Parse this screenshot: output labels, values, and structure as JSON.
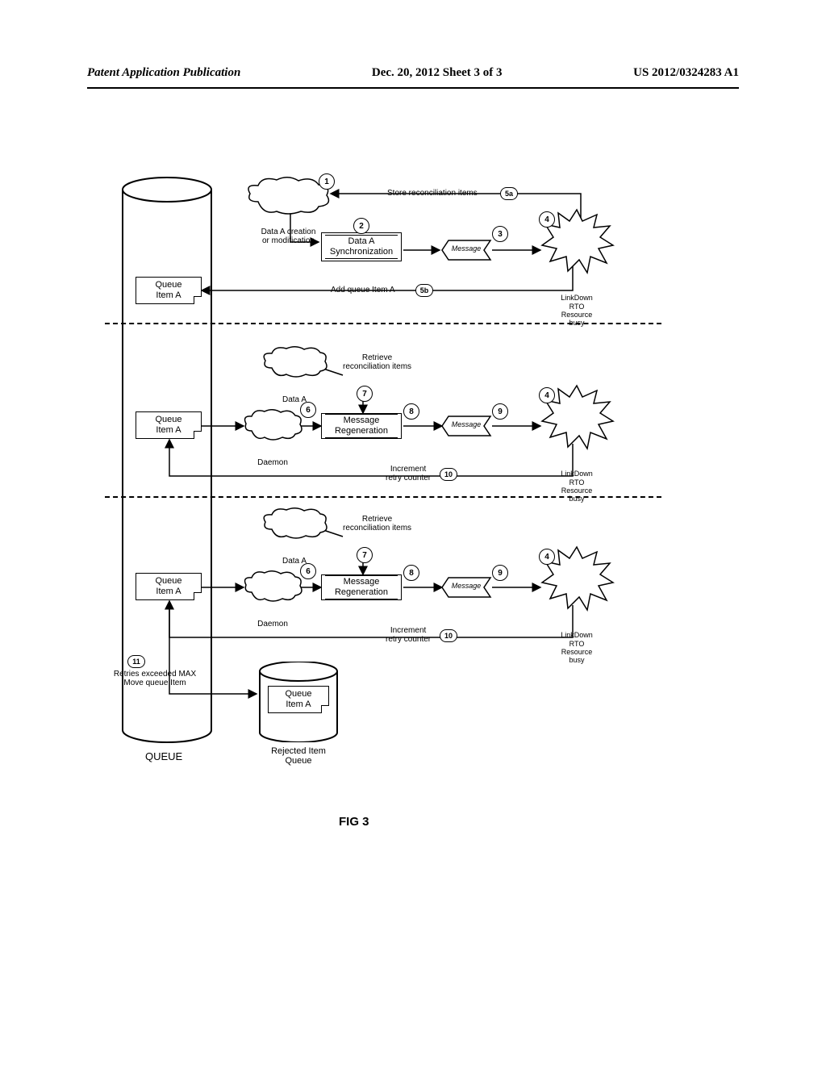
{
  "header": {
    "left": "Patent Application Publication",
    "mid": "Dec. 20, 2012  Sheet 3 of 3",
    "right": "US 2012/0324283 A1"
  },
  "figure_label": "FIG 3",
  "queue": {
    "label": "QUEUE",
    "item_line1": "Queue",
    "item_line2": "Item A"
  },
  "rejected_queue": {
    "line1": "Rejected Item",
    "line2": "Queue",
    "item_line1": "Queue",
    "item_line2": "Item A"
  },
  "clouds": {
    "data_a_creation_l1": "Data A creation",
    "data_a_creation_l2": "or modification",
    "data_a": "Data A",
    "daemon": "Daemon"
  },
  "proc": {
    "sync_l1": "Data A",
    "sync_l2": "Synchronization",
    "regen_l1": "Message",
    "regen_l2": "Regeneration"
  },
  "msg": "Message",
  "star": {
    "l1": "LinkDown",
    "l2": "RTO",
    "l3": "Resource",
    "l4": "busy"
  },
  "labels": {
    "store_items": "Store reconciliation items",
    "add_queue": "Add queue Item A",
    "retrieve_l1": "Retrieve",
    "retrieve_l2": "reconciliation items",
    "inc_retry_l1": "Increment",
    "inc_retry_l2": "retry counter",
    "retries_l1": "Retries exceeded MAX",
    "retries_l2": "Move queue Item"
  },
  "nums": {
    "n1": "1",
    "n2": "2",
    "n3": "3",
    "n4": "4",
    "n5a": "5a",
    "n5b": "5b",
    "n6": "6",
    "n7": "7",
    "n8": "8",
    "n9": "9",
    "n10": "10",
    "n11": "11"
  }
}
